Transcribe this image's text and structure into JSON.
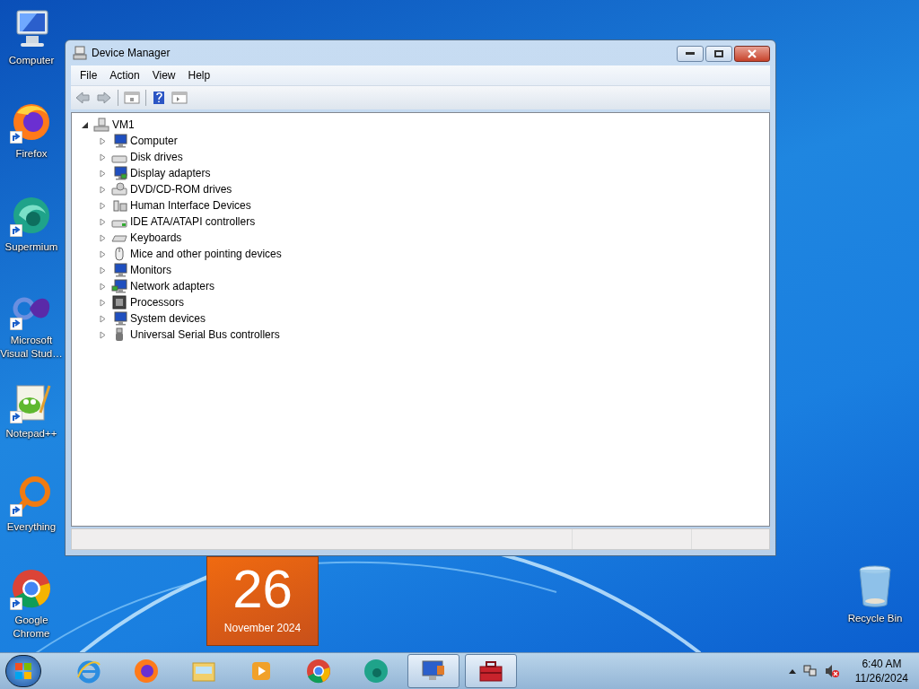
{
  "desktop_icons": [
    {
      "label": "Computer",
      "kind": "computer",
      "shortcut": false
    },
    {
      "label": "Firefox",
      "kind": "firefox",
      "shortcut": true
    },
    {
      "label": "Supermium",
      "kind": "supermium",
      "shortcut": true
    },
    {
      "label": "Microsoft Visual Stud…",
      "kind": "vs",
      "shortcut": true
    },
    {
      "label": "Notepad++",
      "kind": "notepad",
      "shortcut": true
    },
    {
      "label": "Everything",
      "kind": "everything",
      "shortcut": true
    },
    {
      "label": "Google Chrome",
      "kind": "chrome",
      "shortcut": true
    }
  ],
  "recycle_bin": {
    "label": "Recycle Bin"
  },
  "window": {
    "title": "Device Manager",
    "menu": [
      "File",
      "Action",
      "View",
      "Help"
    ],
    "tree": {
      "label": "VM1",
      "expanded": true,
      "children": [
        {
          "label": "Computer",
          "kind": "computer",
          "expanded": false
        },
        {
          "label": "Disk drives",
          "kind": "disk",
          "expanded": false
        },
        {
          "label": "Display adapters",
          "kind": "display",
          "expanded": false
        },
        {
          "label": "DVD/CD-ROM drives",
          "kind": "dvd",
          "expanded": false
        },
        {
          "label": "Human Interface Devices",
          "kind": "hid",
          "expanded": false
        },
        {
          "label": "IDE ATA/ATAPI controllers",
          "kind": "ide",
          "expanded": false
        },
        {
          "label": "Keyboards",
          "kind": "keyboard",
          "expanded": false
        },
        {
          "label": "Mice and other pointing devices",
          "kind": "mouse",
          "expanded": false
        },
        {
          "label": "Monitors",
          "kind": "monitor",
          "expanded": false
        },
        {
          "label": "Network adapters",
          "kind": "network",
          "expanded": false
        },
        {
          "label": "Processors",
          "kind": "cpu",
          "expanded": false
        },
        {
          "label": "System devices",
          "kind": "computer",
          "expanded": false
        },
        {
          "label": "Universal Serial Bus controllers",
          "kind": "usb",
          "expanded": false
        }
      ]
    }
  },
  "calendar_gadget": {
    "day": "26",
    "month_year": "November 2024"
  },
  "taskbar": {
    "apps": [
      {
        "kind": "ie",
        "active": false
      },
      {
        "kind": "firefox",
        "active": false
      },
      {
        "kind": "explorer",
        "active": false
      },
      {
        "kind": "media",
        "active": false
      },
      {
        "kind": "chrome",
        "active": false
      },
      {
        "kind": "supermium",
        "active": false
      },
      {
        "kind": "devmgr",
        "active": true
      },
      {
        "kind": "toolbox",
        "active": true
      }
    ],
    "clock": {
      "time": "6:40 AM",
      "date": "11/26/2024"
    }
  }
}
